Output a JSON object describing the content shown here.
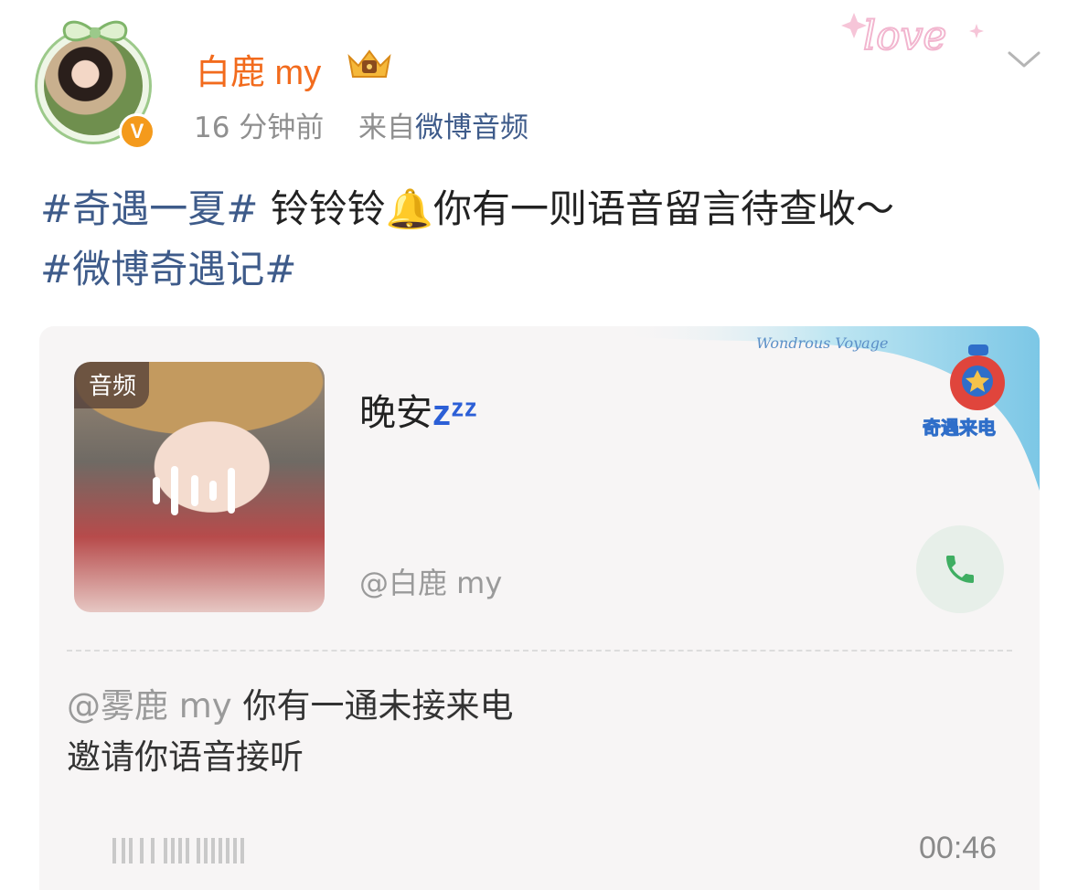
{
  "post": {
    "username": "白鹿 my",
    "verified_mark": "V",
    "time": "16 分钟前",
    "source_prefix": "来自",
    "source": "微博音频",
    "text": {
      "topic1": "#奇遇一夏#",
      "body": " 铃铃铃🔔你有一则语音留言待查收～",
      "topic2": "#微博奇遇记#"
    }
  },
  "card": {
    "tag": "音频",
    "title": "晚安",
    "title_emoji": "zᶻᶻ",
    "author": "@白鹿 my",
    "description_mention": "@雾鹿 my",
    "description_line1": " 你有一通未接来电",
    "description_line2": "邀请你语音接听",
    "duration": "00:46",
    "deco_caption": "Wondrous Voyage",
    "deco_badge": "奇遇来电"
  },
  "deco": {
    "love_text": "love"
  },
  "icons": [
    "crown-icon",
    "chevron-down-icon",
    "phone-icon",
    "audio-wave-icon",
    "waveform-icon",
    "bell-icon"
  ],
  "colors": {
    "username": "#f26b1d",
    "link": "#3e5b8a",
    "meta": "#8f8f8f",
    "card_bg": "#f7f5f5",
    "call_green": "#3fae62"
  }
}
